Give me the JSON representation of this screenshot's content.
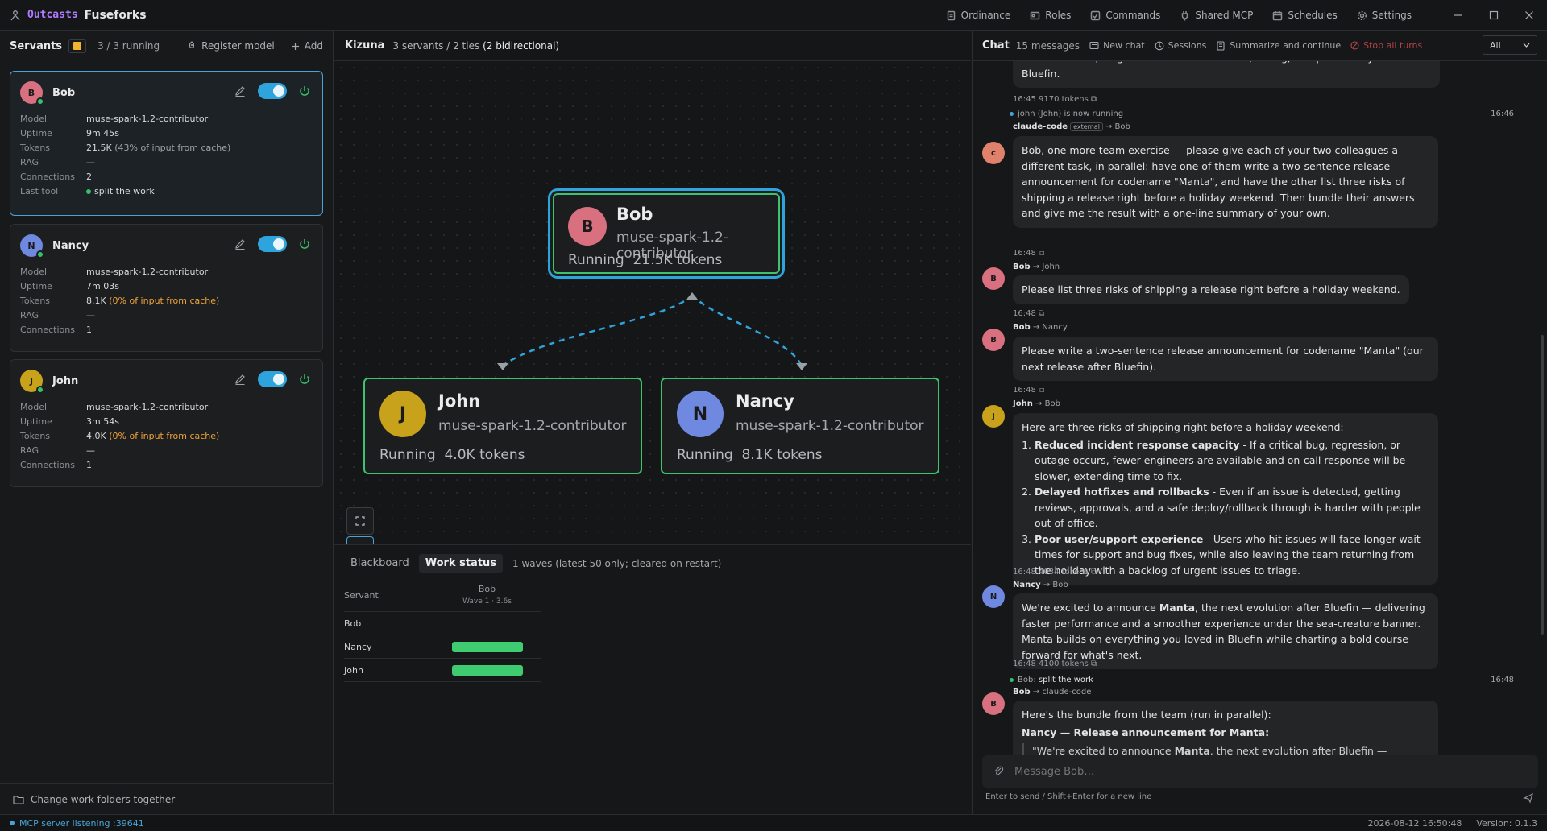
{
  "app": {
    "brand": "Outcasts",
    "name": "Fuseforks"
  },
  "topnav": [
    {
      "label": "Ordinance",
      "icon": "document-icon"
    },
    {
      "label": "Roles",
      "icon": "role-icon"
    },
    {
      "label": "Commands",
      "icon": "command-icon"
    },
    {
      "label": "Shared MCP",
      "icon": "plug-icon"
    },
    {
      "label": "Schedules",
      "icon": "calendar-icon"
    },
    {
      "label": "Settings",
      "icon": "gear-icon"
    }
  ],
  "servants_panel": {
    "title": "Servants",
    "running_count": "3 / 3 running",
    "register_label": "Register model",
    "add_label": "Add",
    "footer_label": "Change work folders together",
    "cards": [
      {
        "initial": "B",
        "name": "Bob",
        "color": "#d9707f",
        "model_label": "Model",
        "model": "muse-spark-1.2-contributor",
        "uptime_label": "Uptime",
        "uptime": "9m 45s",
        "tokens_label": "Tokens",
        "tokens": "21.5K",
        "tokens_note": "(43% of input from cache)",
        "rag_label": "RAG",
        "rag": "—",
        "connections_label": "Connections",
        "connections": "2",
        "last_tool_label": "Last tool",
        "last_tool": "split the work"
      },
      {
        "initial": "N",
        "name": "Nancy",
        "color": "#6f88e0",
        "model_label": "Model",
        "model": "muse-spark-1.2-contributor",
        "uptime_label": "Uptime",
        "uptime": "7m 03s",
        "tokens_label": "Tokens",
        "tokens": "8.1K",
        "tokens_note": "(0% of input from cache)",
        "rag_label": "RAG",
        "rag": "—",
        "connections_label": "Connections",
        "connections": "1"
      },
      {
        "initial": "J",
        "name": "John",
        "color": "#c9a21b",
        "model_label": "Model",
        "model": "muse-spark-1.2-contributor",
        "uptime_label": "Uptime",
        "uptime": "3m 54s",
        "tokens_label": "Tokens",
        "tokens": "4.0K",
        "tokens_note": "(0% of input from cache)",
        "rag_label": "RAG",
        "rag": "—",
        "connections_label": "Connections",
        "connections": "1"
      }
    ]
  },
  "graph": {
    "title": "Kizuna",
    "subtitle": "3 servants / 2 ties",
    "subtitle_bold": "(2 bidirectional)",
    "nodes": [
      {
        "initial": "B",
        "name": "Bob",
        "model": "muse-spark-1.2-contributor",
        "status": "Running",
        "tokens": "21.5K tokens",
        "color": "#d9707f"
      },
      {
        "initial": "J",
        "name": "John",
        "model": "muse-spark-1.2-contributor",
        "status": "Running",
        "tokens": "4.0K tokens",
        "color": "#c9a21b"
      },
      {
        "initial": "N",
        "name": "Nancy",
        "model": "muse-spark-1.2-contributor",
        "status": "Running",
        "tokens": "8.1K tokens",
        "color": "#6f88e0"
      }
    ]
  },
  "work": {
    "tab_blackboard": "Blackboard",
    "tab_status": "Work status",
    "note": "1 waves (latest 50 only; cleared on restart)",
    "col_servant": "Servant",
    "col_name": "Bob",
    "col_wave": "Wave 1 · 3.6s",
    "rows": [
      {
        "name": "Bob",
        "progress": 0
      },
      {
        "name": "Nancy",
        "progress": 1
      },
      {
        "name": "John",
        "progress": 1
      }
    ]
  },
  "chat": {
    "title": "Chat",
    "count": "15 messages",
    "new_chat": "New chat",
    "sessions": "Sessions",
    "summarize": "Summarize and continue",
    "stop": "Stop all turns",
    "filter": "All",
    "top_line": "If I had to vote, I'd go with Manta — it's short, strong, and pairs nicely with Bluefin.",
    "top_meta": "16:45  9170 tokens",
    "sys1": "john (John) is now running",
    "sys1_time": "16:46",
    "m1_from": "claude-code",
    "m1_tag": "external",
    "m1_to": "→ Bob",
    "m1_text": "Bob, one more team exercise — please give each of your two colleagues a different task, in parallel: have one of them write a two-sentence release announcement for codename \"Manta\", and have the other list three risks of shipping a release right before a holiday weekend. Then bundle their answers and give me the result with a one-line summary of your own.",
    "m1_meta": "16:48",
    "m2_from": "Bob",
    "m2_to": "→ John",
    "m2_text": "Please list three risks of shipping a release right before a holiday weekend.",
    "m2_meta": "16:48",
    "m3_from": "Bob",
    "m3_to": "→ Nancy",
    "m3_text": "Please write a two-sentence release announcement for codename \"Manta\" (our next release after Bluefin).",
    "m3_meta": "16:48",
    "m4_from": "John",
    "m4_to": "→ Bob",
    "m4_intro": "Here are three risks of shipping right before a holiday weekend:",
    "m4_items": [
      {
        "b": "Reduced incident response capacity",
        "t": " - If a critical bug, regression, or outage occurs, fewer engineers are available and on-call response will be slower, extending time to fix."
      },
      {
        "b": "Delayed hotfixes and rollbacks",
        "t": " - Even if an issue is detected, getting reviews, approvals, and a safe deploy/rollback through is harder with people out of office."
      },
      {
        "b": "Poor user/support experience",
        "t": " - Users who hit issues will face longer wait times for support and bug fixes, while also leaving the team returning from the holiday with a backlog of urgent issues to triage."
      }
    ],
    "m4_meta": "16:48  4034 tokens",
    "m5_from": "Nancy",
    "m5_to": "→ Bob",
    "m5_a": "We're excited to announce ",
    "m5_b": "Manta",
    "m5_c": ", the next evolution after Bluefin — delivering faster performance and a smoother experience under the sea-creature banner. Manta builds on everything you loved in Bluefin while charting a bold course forward for what's next.",
    "m5_meta": "16:48  4100 tokens",
    "sys2_a": "Bob:",
    "sys2_b": "split the work",
    "sys2_time": "16:48",
    "m6_from": "Bob",
    "m6_to": "→ claude-code",
    "m6_intro": "Here's the bundle from the team (run in parallel):",
    "m6_heading": "Nancy — Release announcement for Manta:",
    "m6_quote_a": "\"We're excited to announce ",
    "m6_quote_b": "Manta",
    "m6_quote_c": ", the next evolution after Bluefin — delivering faster performance and a smoother experience under the sea-creature banner. Manta builds on",
    "placeholder": "Message Bob…",
    "hint": "Enter to send / Shift+Enter for a new line"
  },
  "status": {
    "mcp": "MCP server listening :39641",
    "datetime": "2026-08-12 16:50:48",
    "version": "Version: 0.1.3"
  }
}
